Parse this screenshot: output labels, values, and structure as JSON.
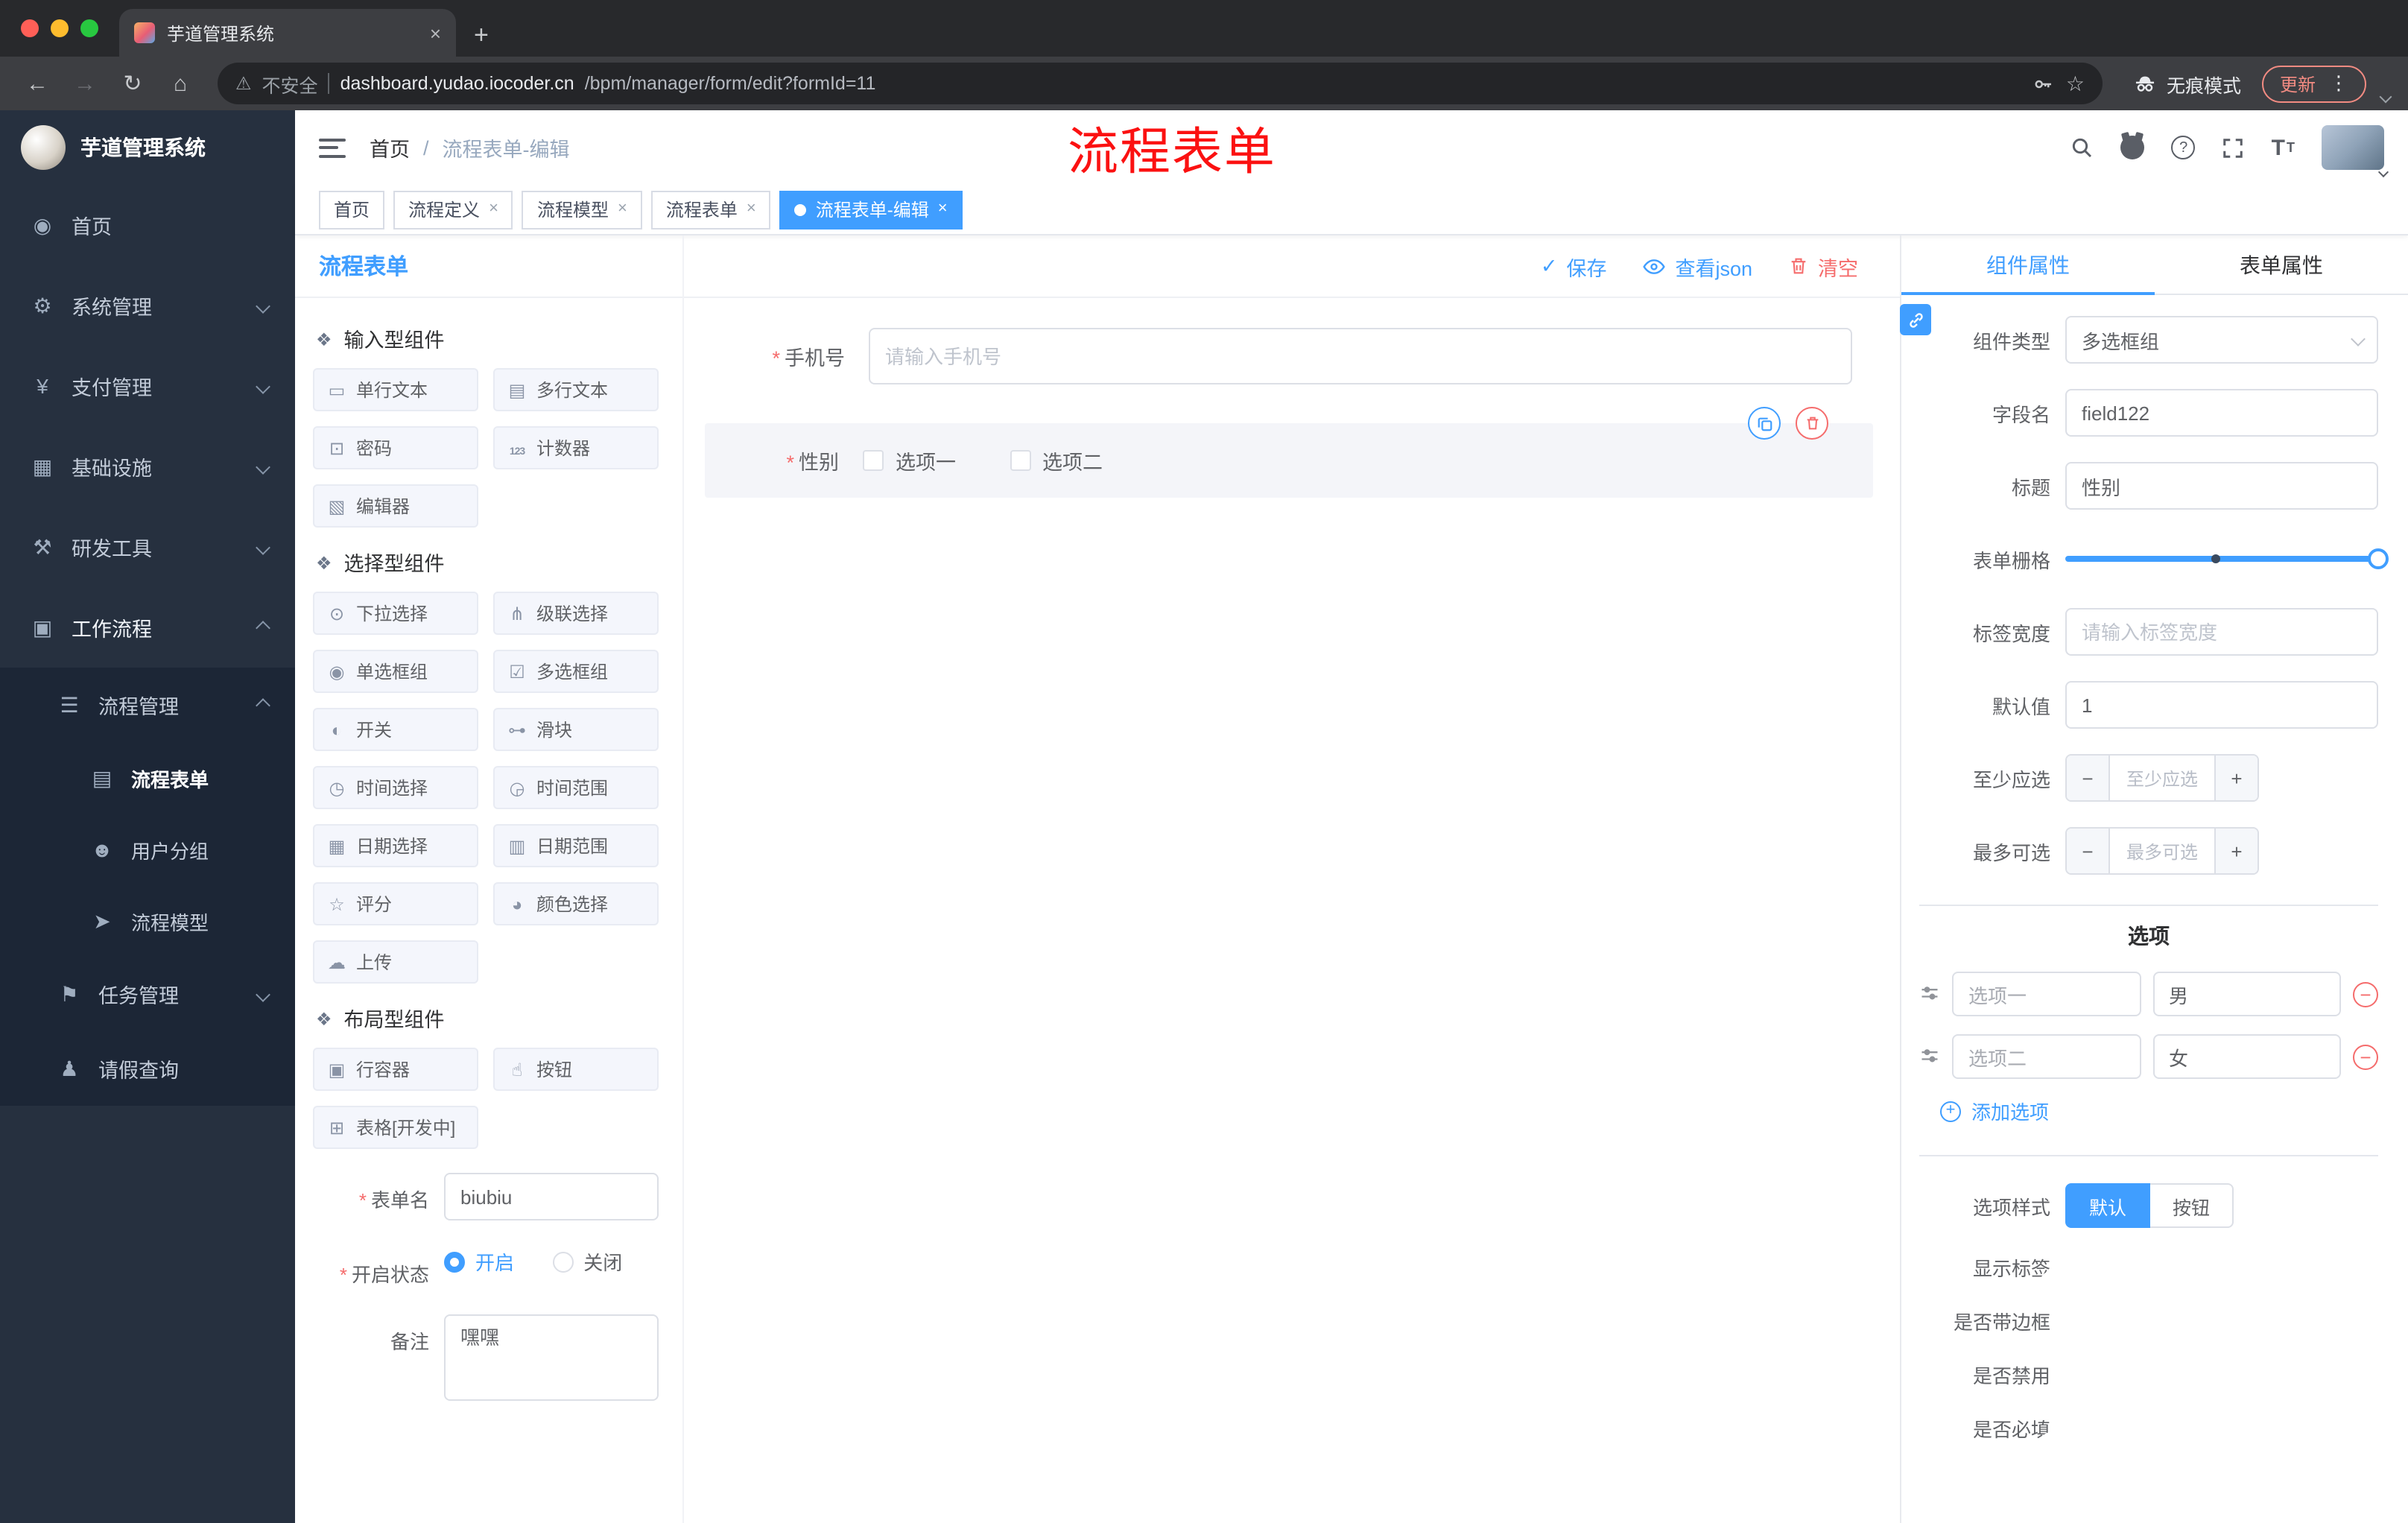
{
  "browser": {
    "tab_title": "芋道管理系统",
    "security_label": "不安全",
    "url_domain": "dashboard.yudao.iocoder.cn",
    "url_path": "/bpm/manager/form/edit?formId=11",
    "incognito_label": "无痕模式",
    "update_label": "更新"
  },
  "sidebar": {
    "logo_title": "芋道管理系统",
    "items": [
      {
        "label": "首页"
      },
      {
        "label": "系统管理"
      },
      {
        "label": "支付管理"
      },
      {
        "label": "基础设施"
      },
      {
        "label": "研发工具"
      },
      {
        "label": "工作流程"
      },
      {
        "label": "流程管理"
      },
      {
        "label": "流程表单"
      },
      {
        "label": "用户分组"
      },
      {
        "label": "流程模型"
      },
      {
        "label": "任务管理"
      },
      {
        "label": "请假查询"
      }
    ]
  },
  "navbar": {
    "breadcrumb_home": "首页",
    "breadcrumb_sep": "/",
    "breadcrumb_current": "流程表单-编辑",
    "annotation": "流程表单"
  },
  "tags": [
    {
      "label": "首页",
      "closable": false,
      "active": false
    },
    {
      "label": "流程定义",
      "closable": true,
      "active": false
    },
    {
      "label": "流程模型",
      "closable": true,
      "active": false
    },
    {
      "label": "流程表单",
      "closable": true,
      "active": false
    },
    {
      "label": "流程表单-编辑",
      "closable": true,
      "active": true
    }
  ],
  "designer": {
    "title": "流程表单",
    "toolbar": {
      "save": "保存",
      "view_json": "查看json",
      "clear": "清空"
    },
    "sections": [
      {
        "title": "输入型组件",
        "items": [
          "单行文本",
          "多行文本",
          "密码",
          "计数器",
          "编辑器"
        ]
      },
      {
        "title": "选择型组件",
        "items": [
          "下拉选择",
          "级联选择",
          "单选框组",
          "多选框组",
          "开关",
          "滑块",
          "时间选择",
          "时间范围",
          "日期选择",
          "日期范围",
          "评分",
          "颜色选择",
          "上传"
        ]
      },
      {
        "title": "布局型组件",
        "items": [
          "行容器",
          "按钮",
          "表格[开发中]"
        ]
      }
    ],
    "meta": {
      "form_name_label": "表单名",
      "form_name_value": "biubiu",
      "status_label": "开启状态",
      "status_on": "开启",
      "status_off": "关闭",
      "remark_label": "备注",
      "remark_value": "嘿嘿"
    },
    "canvas": {
      "phone_label": "手机号",
      "phone_placeholder": "请输入手机号",
      "gender_label": "性别",
      "gender_options": [
        "选项一",
        "选项二"
      ]
    }
  },
  "props": {
    "tab_component": "组件属性",
    "tab_form": "表单属性",
    "component_type_label": "组件类型",
    "component_type_value": "多选框组",
    "field_name_label": "字段名",
    "field_name_value": "field122",
    "title_label": "标题",
    "title_value": "性别",
    "grid_label": "表单栅格",
    "label_width_label": "标签宽度",
    "label_width_placeholder": "请输入标签宽度",
    "default_label": "默认值",
    "default_value": "1",
    "min_label": "至少应选",
    "min_placeholder": "至少应选",
    "max_label": "最多可选",
    "max_placeholder": "最多可选",
    "options_title": "选项",
    "options": [
      {
        "label": "选项一",
        "value": "男"
      },
      {
        "label": "选项二",
        "value": "女"
      }
    ],
    "add_option": "添加选项",
    "style_label": "选项样式",
    "style_options": [
      {
        "label": "默认",
        "active": true
      },
      {
        "label": "按钮",
        "active": false
      }
    ],
    "toggles": [
      {
        "label": "显示标签",
        "on": true
      },
      {
        "label": "是否带边框",
        "on": false
      },
      {
        "label": "是否禁用",
        "on": false
      },
      {
        "label": "是否必填",
        "on": true
      }
    ]
  },
  "colors": {
    "accent": "#409eff",
    "danger": "#f56c6c",
    "annotation": "#fb1111"
  }
}
